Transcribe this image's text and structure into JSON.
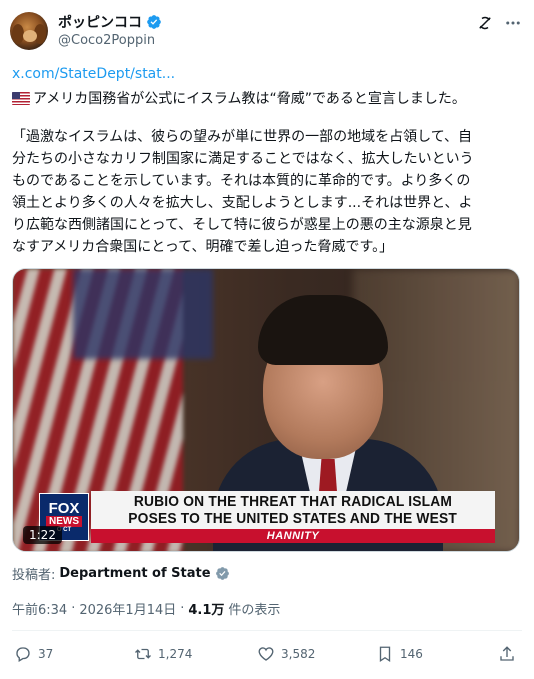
{
  "tweet": {
    "display_name": "ポッピンココ",
    "handle": "@Coco2Poppin",
    "link_text": "x.com/StateDept/stat...",
    "line1": "アメリカ国務省が公式にイスラム教は“脅威”であると宣言しました。",
    "quote": "「過激なイスラムは、彼らの望みが単に世界の一部の地域を占領して、自\n分たちの小さなカリフ制国家に満足することではなく、拡大したいという\nものであることを示しています。それは本質的に革命的です。より多くの\n領土とより多くの人々を拡大し、支配しようとします...それは世界と、よ\nり広範な西側諸国にとって、そして特に彼らが惑星上の悪の主な源泉と見\nなすアメリカ合衆国にとって、明確で差し迫った脅威です。」"
  },
  "media": {
    "chyron_line1": "RUBIO ON THE THREAT THAT RADICAL ISLAM",
    "chyron_line2": "POSES TO THE UNITED STATES AND THE WEST",
    "show": "HANNITY",
    "logo_fox": "FOX",
    "logo_news": "NEWS",
    "logo_channel": "O CT",
    "duration": "1:22"
  },
  "author": {
    "label": "投稿者:",
    "name": "Department of State"
  },
  "meta": {
    "time": "午前6:34",
    "sep1": "·",
    "date": "2026年1月14日",
    "sep2": "·",
    "views": "4.1万",
    "views_suffix": "件の表示"
  },
  "actions": {
    "replies": "37",
    "reposts": "1,274",
    "likes": "3,582",
    "bookmarks": "146"
  },
  "colors": {
    "accent": "#1d9bf0",
    "text": "#0f1419",
    "muted": "#536471",
    "fox_red": "#c8102e",
    "fox_blue": "#0a2a6b"
  },
  "icons": [
    "verified-badge-icon",
    "grok-icon",
    "more-icon",
    "us-flag-icon",
    "gov-badge-icon",
    "reply-icon",
    "repost-icon",
    "like-icon",
    "bookmark-icon",
    "share-icon"
  ]
}
